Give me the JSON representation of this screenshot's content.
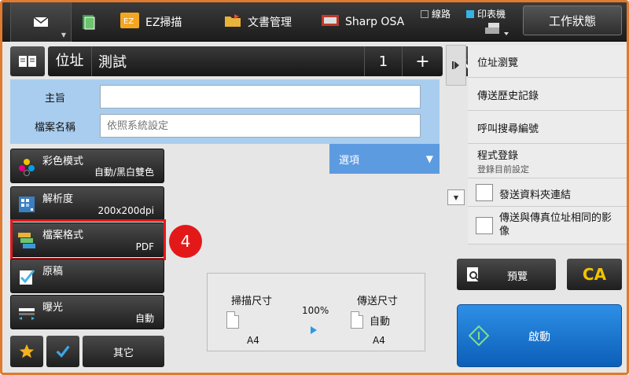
{
  "topbar": {
    "tabs": [
      {
        "id": "mail",
        "icon": "envelope-icon"
      },
      {
        "id": "ftp",
        "icon": "document-icon"
      },
      {
        "id": "ez",
        "label": "EZ掃描",
        "icon": "ez-icon"
      },
      {
        "id": "doc",
        "label": "文書管理",
        "icon": "folder-icon"
      },
      {
        "id": "osa",
        "label": "Sharp OSA",
        "icon": "osa-icon"
      }
    ],
    "status_line": "線路",
    "status_printer": "印表機",
    "work_status": "工作狀態"
  },
  "address": {
    "label": "位址",
    "value": "測試",
    "count": "1",
    "plus": "+"
  },
  "subject_panel": {
    "subject_label": "主旨",
    "subject_value": "",
    "filename_label": "檔案名稱",
    "filename_placeholder": "依照系統設定",
    "options_label": "選項"
  },
  "settings": [
    {
      "label": "彩色模式",
      "value": "自動/黑白雙色",
      "icon": "color-mode-icon"
    },
    {
      "label": "解析度",
      "value": "200x200dpi",
      "icon": "resolution-icon"
    },
    {
      "label": "檔案格式",
      "value": "PDF",
      "icon": "file-format-icon"
    },
    {
      "label": "原稿",
      "value": "",
      "icon": "original-icon"
    },
    {
      "label": "曝光",
      "value": "自動",
      "icon": "exposure-icon"
    }
  ],
  "step_badge": "4",
  "bottom": {
    "other_label": "其它"
  },
  "scan_size": {
    "scan_label": "掃描尺寸",
    "scan_value": "A4",
    "ratio": "100%",
    "send_label": "傳送尺寸",
    "send_value": "自動",
    "send_paper": "A4"
  },
  "right_panel": {
    "items": [
      {
        "label": "位址瀏覽"
      },
      {
        "label": "傳送歷史記錄"
      },
      {
        "label": "呼叫搜尋編號"
      },
      {
        "label": "程式登錄",
        "sub": "登錄目前設定"
      }
    ],
    "checks": [
      {
        "label": "發送資料夾連結",
        "checked": false
      },
      {
        "label": "傳送與傳真位址相同的影像",
        "checked": false
      }
    ]
  },
  "actions": {
    "preview": "預覽",
    "ca": "CA",
    "start": "啟動"
  },
  "colors": {
    "frame": "#e07a2e",
    "highlight": "#e31919",
    "panel_blue": "#a9cdee",
    "options_blue": "#5d9be0",
    "start_blue": "#1f78d1",
    "ca_yellow": "#f1c400"
  }
}
